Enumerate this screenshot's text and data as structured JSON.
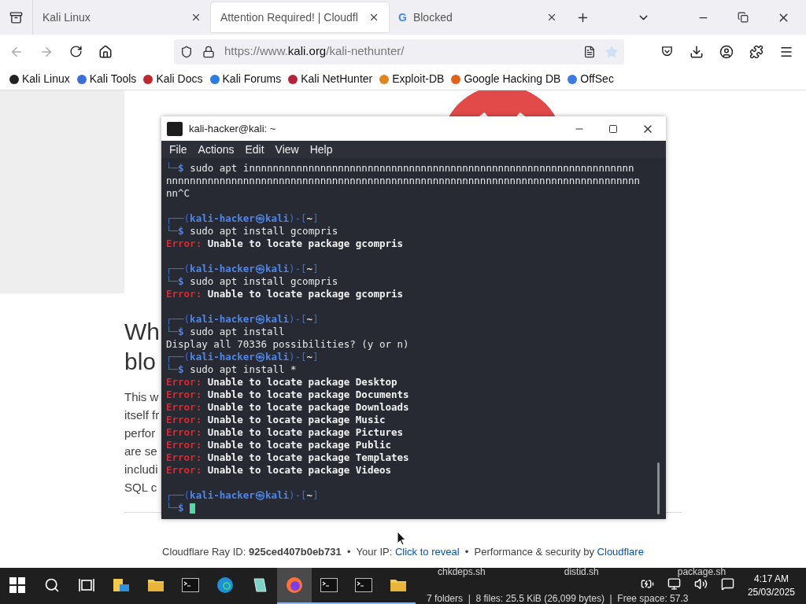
{
  "browser": {
    "tabs": [
      {
        "title": "Kali Linux",
        "selected": false
      },
      {
        "title": "Attention Required! | Cloudfl",
        "selected": true
      },
      {
        "title": "Blocked",
        "selected": false,
        "favicon": "G"
      }
    ],
    "url": {
      "prefix": "https://www.",
      "domain": "kali.org",
      "path": "/kali-nethunter/"
    },
    "bookmarks": [
      {
        "label": "Kali Linux",
        "color": "#222222"
      },
      {
        "label": "Kali Tools",
        "color": "#3b6fd6"
      },
      {
        "label": "Kali Docs",
        "color": "#c0262d"
      },
      {
        "label": "Kali Forums",
        "color": "#2a7de1"
      },
      {
        "label": "Kali NetHunter",
        "color": "#b3263a"
      },
      {
        "label": "Exploit-DB",
        "color": "#e0851f"
      },
      {
        "label": "Google Hacking DB",
        "color": "#e2611b"
      },
      {
        "label": "OffSec",
        "color": "#3c7be0"
      }
    ]
  },
  "page": {
    "heading_fragments": [
      "Wh",
      "blo"
    ],
    "paragraph_fragments": [
      "This w",
      "itself fr",
      "perfor",
      "are se",
      "includi",
      "SQL c"
    ],
    "footer": "Cloudflare Ray ID: **925ced407b0eb731**  •  Your IP: ",
    "reveal_link": "Click to reveal",
    "footer_middle": "  •  Performance & security by ",
    "cloudflare_link": "Cloudflare"
  },
  "terminal": {
    "title": "kali-hacker@kali: ~",
    "menu": [
      "File",
      "Actions",
      "Edit",
      "View",
      "Help"
    ],
    "lines": [
      {
        "kind": "cmd",
        "corner": "└─",
        "sign": "$",
        "command": "sudo apt innnnnnnnnnnnnnnnnnnnnnnnnnnnnnnnnnnnnnnnnnnnnnnnnnnnnnnnnnnnnnnnn",
        "cursor": false
      },
      {
        "kind": "output",
        "text": "nnnnnnnnnnnnnnnnnnnnnnnnnnnnnnnnnnnnnnnnnnnnnnnnnnnnnnnnnnnnnnnnnnnnnnnnnnnnnnnn"
      },
      {
        "kind": "output",
        "text": "nn^C"
      },
      {
        "kind": "blank"
      },
      {
        "kind": "head",
        "open": "┌──(",
        "user": "kali-hacker",
        "at": "㉿",
        "host": "kali",
        "close": ")-[",
        "dir": "~",
        "end": "]"
      },
      {
        "kind": "cmd",
        "corner": "└─",
        "sign": "$",
        "command": "sudo apt install gcompris",
        "cursor": false
      },
      {
        "kind": "error",
        "label": "Error:",
        "message": "Unable to locate package gcompris"
      },
      {
        "kind": "blank"
      },
      {
        "kind": "head",
        "open": "┌──(",
        "user": "kali-hacker",
        "at": "㉿",
        "host": "kali",
        "close": ")-[",
        "dir": "~",
        "end": "]"
      },
      {
        "kind": "cmd",
        "corner": "└─",
        "sign": "$",
        "command": "sudo apt install gcompris",
        "cursor": false
      },
      {
        "kind": "error",
        "label": "Error:",
        "message": "Unable to locate package gcompris"
      },
      {
        "kind": "blank"
      },
      {
        "kind": "head",
        "open": "┌──(",
        "user": "kali-hacker",
        "at": "㉿",
        "host": "kali",
        "close": ")-[",
        "dir": "~",
        "end": "]"
      },
      {
        "kind": "cmd",
        "corner": "└─",
        "sign": "$",
        "command": "sudo apt install",
        "cursor": false
      },
      {
        "kind": "output",
        "text": "Display all 70336 possibilities? (y or n)"
      },
      {
        "kind": "head",
        "open": "┌──(",
        "user": "kali-hacker",
        "at": "㉿",
        "host": "kali",
        "close": ")-[",
        "dir": "~",
        "end": "]"
      },
      {
        "kind": "cmd",
        "corner": "└─",
        "sign": "$",
        "command": "sudo apt install *",
        "cursor": false
      },
      {
        "kind": "error",
        "label": "Error:",
        "message": "Unable to locate package Desktop"
      },
      {
        "kind": "error",
        "label": "Error:",
        "message": "Unable to locate package Documents"
      },
      {
        "kind": "error",
        "label": "Error:",
        "message": "Unable to locate package Downloads"
      },
      {
        "kind": "error",
        "label": "Error:",
        "message": "Unable to locate package Music"
      },
      {
        "kind": "error",
        "label": "Error:",
        "message": "Unable to locate package Pictures"
      },
      {
        "kind": "error",
        "label": "Error:",
        "message": "Unable to locate package Public"
      },
      {
        "kind": "error",
        "label": "Error:",
        "message": "Unable to locate package Templates"
      },
      {
        "kind": "error",
        "label": "Error:",
        "message": "Unable to locate package Videos"
      },
      {
        "kind": "blank"
      },
      {
        "kind": "head",
        "open": "┌──(",
        "user": "kali-hacker",
        "at": "㉿",
        "host": "kali",
        "close": ")-[",
        "dir": "~",
        "end": "]"
      },
      {
        "kind": "cmd",
        "corner": "└─",
        "sign": "$",
        "cursor": true
      }
    ]
  },
  "file_manager_ghost": {
    "files": [
      "chkdeps.sh",
      "distid.sh",
      "package.sh"
    ],
    "status": "7 folders  |  8 files: 25.5 KiB (26,099 bytes)  |  Free space: 57.3"
  },
  "taskbar": {
    "apps": [
      {
        "kind": "start",
        "active": false,
        "running": false
      },
      {
        "kind": "search",
        "active": false,
        "running": false
      },
      {
        "kind": "taskview",
        "active": false,
        "running": false
      },
      {
        "kind": "explorer",
        "active": false,
        "running": false
      },
      {
        "kind": "folder",
        "active": false,
        "running": false
      },
      {
        "kind": "terminal",
        "active": false,
        "running": false
      },
      {
        "kind": "edge",
        "active": false,
        "running": false
      },
      {
        "kind": "notes",
        "active": false,
        "running": false
      },
      {
        "kind": "firefox",
        "active": true,
        "running": true
      },
      {
        "kind": "terminal",
        "active": false,
        "running": true
      },
      {
        "kind": "terminal",
        "active": false,
        "running": true
      },
      {
        "kind": "folder",
        "active": false,
        "running": true
      }
    ],
    "time": "4:17 AM",
    "date": "25/03/2025"
  }
}
